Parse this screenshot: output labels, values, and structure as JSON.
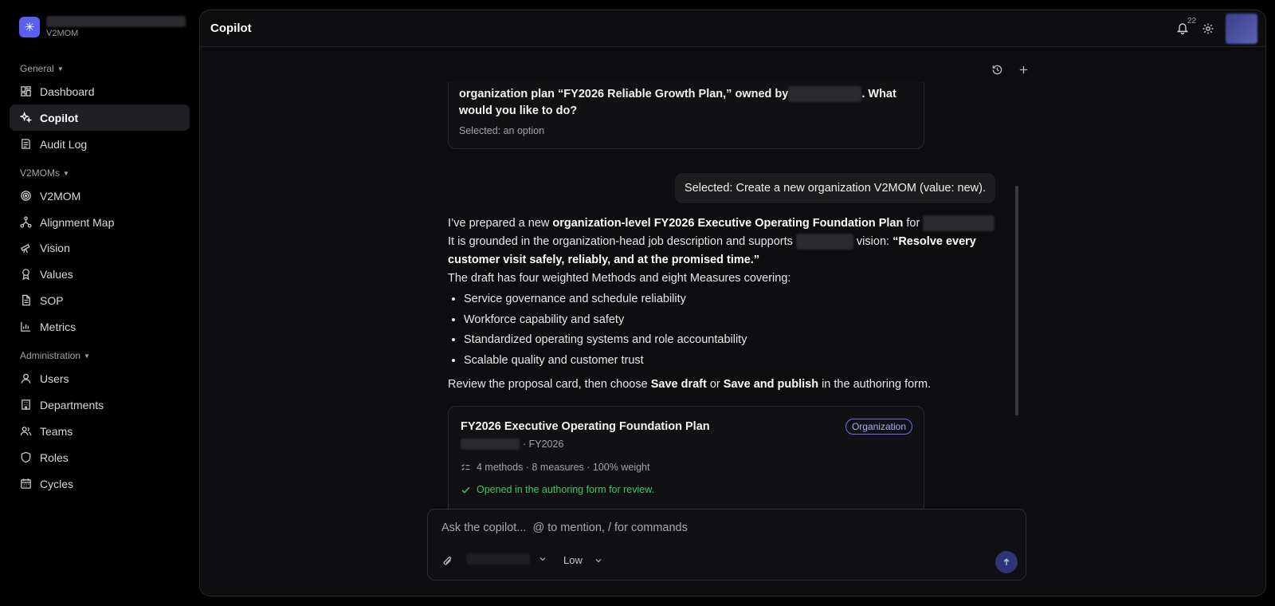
{
  "brand": {
    "subtitle": "V2MOM",
    "logo_icon": "asterisk-icon",
    "accent": "#5b5ff0"
  },
  "sidebar": {
    "sections": {
      "general": "General",
      "v2moms": "V2MOMs",
      "administration": "Administration"
    },
    "items": [
      {
        "label": "Dashboard",
        "icon": "dashboard-icon"
      },
      {
        "label": "Copilot",
        "icon": "sparkles-icon",
        "active": true
      },
      {
        "label": "Audit Log",
        "icon": "audit-log-icon"
      },
      {
        "label": "V2MOM",
        "icon": "target-icon"
      },
      {
        "label": "Alignment Map",
        "icon": "network-icon"
      },
      {
        "label": "Vision",
        "icon": "telescope-icon"
      },
      {
        "label": "Values",
        "icon": "award-icon"
      },
      {
        "label": "SOP",
        "icon": "document-icon"
      },
      {
        "label": "Metrics",
        "icon": "bar-chart-icon"
      },
      {
        "label": "Users",
        "icon": "user-icon"
      },
      {
        "label": "Departments",
        "icon": "building-icon"
      },
      {
        "label": "Teams",
        "icon": "users-icon"
      },
      {
        "label": "Roles",
        "icon": "shield-icon"
      },
      {
        "label": "Cycles",
        "icon": "calendar-icon"
      }
    ]
  },
  "header": {
    "title": "Copilot",
    "notification_count": "22"
  },
  "chat": {
    "prev_card": {
      "question_part1": "organization plan “FY2026 Reliable Growth Plan,” owned by",
      "question_part2": ". What would you like to do?",
      "selected": "Selected: an option"
    },
    "user_message": "Selected: Create a new organization V2MOM (value: new).",
    "assistant": {
      "p1_a": "I’ve prepared a new ",
      "p1_b": "organization-level FY2026 Executive Operating Foundation Plan",
      "p1_c": " for ",
      "p2_a": "It is grounded in the organization-head job description and supports ",
      "p2_b": " vision: ",
      "p2_c": "“Resolve every customer visit safely, reliably, and at the promised time.”",
      "p3": "The draft has four weighted Methods and eight Measures covering:",
      "bullets": [
        "Service governance and schedule reliability",
        "Workforce capability and safety",
        "Standardized operating systems and role accountability",
        "Scalable quality and customer trust"
      ],
      "review_a": "Review the proposal card, then choose ",
      "review_b": "Save draft",
      "review_c": " or ",
      "review_d": "Save and publish",
      "review_e": " in the authoring form."
    },
    "proposal_card": {
      "title": "FY2026 Executive Operating Foundation Plan",
      "badge": "Organization",
      "cycle": "· FY2026",
      "meta": "4 methods · 8 measures · 100% weight",
      "status": "Opened in the authoring form for review."
    }
  },
  "composer": {
    "placeholder": "Ask the copilot...  @ to mention, / for commands",
    "effort": "Low"
  }
}
